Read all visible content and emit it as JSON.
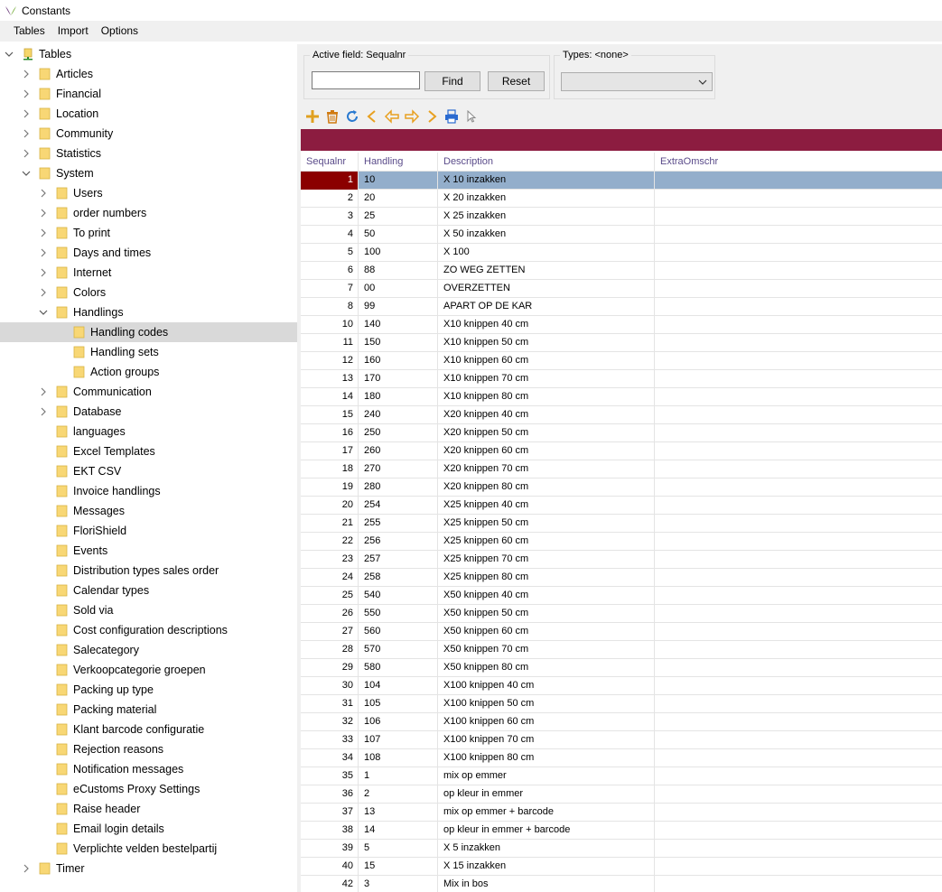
{
  "window": {
    "title": "Constants"
  },
  "menu": [
    "Tables",
    "Import",
    "Options"
  ],
  "tree": [
    {
      "label": "Tables",
      "level": 0,
      "expander": "expanded",
      "icon": "tables-root-icon"
    },
    {
      "label": "Articles",
      "level": 1,
      "expander": "collapsed"
    },
    {
      "label": "Financial",
      "level": 1,
      "expander": "collapsed"
    },
    {
      "label": "Location",
      "level": 1,
      "expander": "collapsed"
    },
    {
      "label": "Community",
      "level": 1,
      "expander": "collapsed"
    },
    {
      "label": "Statistics",
      "level": 1,
      "expander": "collapsed"
    },
    {
      "label": "System",
      "level": 1,
      "expander": "expanded"
    },
    {
      "label": "Users",
      "level": 2,
      "expander": "collapsed"
    },
    {
      "label": "order numbers",
      "level": 2,
      "expander": "collapsed"
    },
    {
      "label": "To print",
      "level": 2,
      "expander": "collapsed"
    },
    {
      "label": "Days and times",
      "level": 2,
      "expander": "collapsed"
    },
    {
      "label": "Internet",
      "level": 2,
      "expander": "collapsed"
    },
    {
      "label": "Colors",
      "level": 2,
      "expander": "collapsed"
    },
    {
      "label": "Handlings",
      "level": 2,
      "expander": "expanded"
    },
    {
      "label": "Handling codes",
      "level": 3,
      "expander": "none",
      "selected": true
    },
    {
      "label": "Handling sets",
      "level": 3,
      "expander": "none"
    },
    {
      "label": "Action groups",
      "level": 3,
      "expander": "none"
    },
    {
      "label": "Communication",
      "level": 2,
      "expander": "collapsed"
    },
    {
      "label": "Database",
      "level": 2,
      "expander": "collapsed"
    },
    {
      "label": "languages",
      "level": 2,
      "expander": "none"
    },
    {
      "label": "Excel Templates",
      "level": 2,
      "expander": "none"
    },
    {
      "label": "EKT CSV",
      "level": 2,
      "expander": "none"
    },
    {
      "label": "Invoice handlings",
      "level": 2,
      "expander": "none"
    },
    {
      "label": "Messages",
      "level": 2,
      "expander": "none"
    },
    {
      "label": "FloriShield",
      "level": 2,
      "expander": "none"
    },
    {
      "label": "Events",
      "level": 2,
      "expander": "none"
    },
    {
      "label": "Distribution types sales order",
      "level": 2,
      "expander": "none"
    },
    {
      "label": "Calendar types",
      "level": 2,
      "expander": "none"
    },
    {
      "label": "Sold via",
      "level": 2,
      "expander": "none"
    },
    {
      "label": "Cost configuration descriptions",
      "level": 2,
      "expander": "none"
    },
    {
      "label": "Salecategory",
      "level": 2,
      "expander": "none"
    },
    {
      "label": "Verkoopcategorie groepen",
      "level": 2,
      "expander": "none"
    },
    {
      "label": "Packing up type",
      "level": 2,
      "expander": "none"
    },
    {
      "label": "Packing material",
      "level": 2,
      "expander": "none"
    },
    {
      "label": "Klant barcode configuratie",
      "level": 2,
      "expander": "none"
    },
    {
      "label": "Rejection reasons",
      "level": 2,
      "expander": "none"
    },
    {
      "label": "Notification messages",
      "level": 2,
      "expander": "none"
    },
    {
      "label": "eCustoms Proxy Settings",
      "level": 2,
      "expander": "none"
    },
    {
      "label": "Raise header",
      "level": 2,
      "expander": "none"
    },
    {
      "label": "Email login details",
      "level": 2,
      "expander": "none"
    },
    {
      "label": "Verplichte velden bestelpartij",
      "level": 2,
      "expander": "none"
    },
    {
      "label": "Timer",
      "level": 1,
      "expander": "collapsed"
    }
  ],
  "search": {
    "legend": "Active field: Sequalnr",
    "value": "",
    "find_label": "Find",
    "reset_label": "Reset"
  },
  "types": {
    "legend": "Types: <none>",
    "selected": ""
  },
  "toolbar": [
    {
      "icon": "add-icon",
      "color": "#e0a020"
    },
    {
      "icon": "delete-icon",
      "color": "#d07a10"
    },
    {
      "icon": "refresh-icon",
      "color": "#2a7ad0"
    },
    {
      "icon": "first-icon",
      "color": "#e8a020"
    },
    {
      "icon": "previous-icon",
      "color": "#e8a020"
    },
    {
      "icon": "next-icon",
      "color": "#e8a020"
    },
    {
      "icon": "last-icon",
      "color": "#e8a020"
    },
    {
      "icon": "print-icon",
      "color": "#2a6ad0"
    },
    {
      "icon": "pointer-icon",
      "color": "#888888"
    }
  ],
  "colors": {
    "banner": "#8c1c40",
    "current_row": "#93aecb",
    "current_indicator": "#8b0000",
    "header_text": "#5a4b8a"
  },
  "grid": {
    "columns": [
      "Sequalnr",
      "Handling",
      "Description",
      "ExtraOmschr"
    ],
    "rows": [
      [
        "1",
        "10",
        "X 10 inzakken",
        ""
      ],
      [
        "2",
        "20",
        "X 20 inzakken",
        ""
      ],
      [
        "3",
        "25",
        "X 25 inzakken",
        ""
      ],
      [
        "4",
        "50",
        "X 50 inzakken",
        ""
      ],
      [
        "5",
        "100",
        "X 100",
        ""
      ],
      [
        "6",
        "88",
        "ZO WEG ZETTEN",
        ""
      ],
      [
        "7",
        "00",
        "OVERZETTEN",
        ""
      ],
      [
        "8",
        "99",
        "APART OP DE KAR",
        ""
      ],
      [
        "10",
        "140",
        "X10 knippen 40 cm",
        ""
      ],
      [
        "11",
        "150",
        "X10 knippen 50 cm",
        ""
      ],
      [
        "12",
        "160",
        "X10 knippen 60 cm",
        ""
      ],
      [
        "13",
        "170",
        "X10 knippen 70 cm",
        ""
      ],
      [
        "14",
        "180",
        "X10 knippen 80 cm",
        ""
      ],
      [
        "15",
        "240",
        "X20 knippen 40 cm",
        ""
      ],
      [
        "16",
        "250",
        "X20 knippen 50 cm",
        ""
      ],
      [
        "17",
        "260",
        "X20 knippen 60 cm",
        ""
      ],
      [
        "18",
        "270",
        "X20 knippen 70 cm",
        ""
      ],
      [
        "19",
        "280",
        "X20 knippen 80 cm",
        ""
      ],
      [
        "20",
        "254",
        "X25 knippen 40 cm",
        ""
      ],
      [
        "21",
        "255",
        "X25 knippen 50 cm",
        ""
      ],
      [
        "22",
        "256",
        "X25 knippen 60 cm",
        ""
      ],
      [
        "23",
        "257",
        "X25 knippen 70 cm",
        ""
      ],
      [
        "24",
        "258",
        "X25 knippen 80 cm",
        ""
      ],
      [
        "25",
        "540",
        "X50 knippen 40 cm",
        ""
      ],
      [
        "26",
        "550",
        "X50 knippen 50 cm",
        ""
      ],
      [
        "27",
        "560",
        "X50 knippen 60 cm",
        ""
      ],
      [
        "28",
        "570",
        "X50 knippen 70 cm",
        ""
      ],
      [
        "29",
        "580",
        "X50 knippen 80 cm",
        ""
      ],
      [
        "30",
        "104",
        "X100 knippen 40 cm",
        ""
      ],
      [
        "31",
        "105",
        "X100 knippen 50 cm",
        ""
      ],
      [
        "32",
        "106",
        "X100 knippen 60 cm",
        ""
      ],
      [
        "33",
        "107",
        "X100 knippen 70 cm",
        ""
      ],
      [
        "34",
        "108",
        "X100 knippen 80 cm",
        ""
      ],
      [
        "35",
        "1",
        "mix op emmer",
        ""
      ],
      [
        "36",
        "2",
        "op kleur in emmer",
        ""
      ],
      [
        "37",
        "13",
        "mix op emmer + barcode",
        ""
      ],
      [
        "38",
        "14",
        "op kleur in emmer + barcode",
        ""
      ],
      [
        "39",
        "5",
        "X 5 inzakken",
        ""
      ],
      [
        "40",
        "15",
        "X 15 inzakken",
        ""
      ],
      [
        "42",
        "3",
        "Mix in bos",
        ""
      ]
    ],
    "current_row": 0
  }
}
